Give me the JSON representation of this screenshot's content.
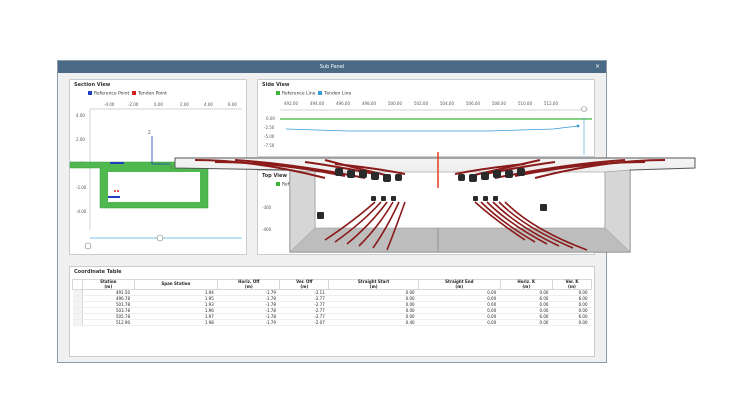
{
  "window": {
    "title": "Sub Panel",
    "close_glyph": "×"
  },
  "section_view": {
    "title": "Section View",
    "legend": [
      {
        "label": "Reference Point",
        "color": "#1f3fbf"
      },
      {
        "label": "Tendon Point",
        "color": "#d42020"
      }
    ],
    "x_ticks": [
      "-4.00",
      "-2.00",
      "0.00",
      "2.00",
      "4.00",
      "6.00"
    ],
    "y_ticks": [
      "4.00",
      "2.00",
      "0.00",
      "-2.00",
      "-4.00"
    ],
    "axis_z": "Z",
    "axis_y": "Y"
  },
  "side_view": {
    "title": "Side View",
    "legend": [
      {
        "label": "Reference Line",
        "color": "#3cb43c"
      },
      {
        "label": "Tendon Line",
        "color": "#3a9ad9"
      }
    ],
    "x_ticks": [
      "492.00",
      "494.00",
      "496.00",
      "498.00",
      "500.00",
      "502.00",
      "504.00",
      "506.00",
      "508.00",
      "510.00",
      "512.00"
    ],
    "y_ticks": [
      "0.00",
      "-2.50",
      "-5.00",
      "-7.50"
    ]
  },
  "top_view": {
    "title": "Top View",
    "legend_partial": "Refere",
    "y_ticks": [
      "-300",
      "-400"
    ]
  },
  "coordinate_table": {
    "title": "Coordinate Table",
    "headers": [
      "Station\n(m)",
      "Span Station",
      "Horiz. Off\n(m)",
      "Ver. Off\n(m)",
      "Straight Start\n(m)",
      "Straight End\n(m)",
      "Horiz. K\n(m)",
      "Ver. K\n(m)"
    ],
    "rows": [
      [
        "491.50",
        "1.94",
        "-1.79",
        "-2.11",
        "0.00",
        "0.00",
        "0.00",
        "0.00"
      ],
      [
        "496.78",
        "1.95",
        "-1.78",
        "-2.77",
        "0.00",
        "0.00",
        "6.00",
        "6.00"
      ],
      [
        "501.78",
        "1.93",
        "-1.78",
        "-2.77",
        "0.00",
        "0.00",
        "0.00",
        "0.00"
      ],
      [
        "503.78",
        "1.96",
        "-1.78",
        "-2.77",
        "0.00",
        "0.00",
        "0.00",
        "0.00"
      ],
      [
        "505.78",
        "1.97",
        "-1.78",
        "-2.77",
        "0.00",
        "0.00",
        "6.00",
        "6.00"
      ],
      [
        "512.90",
        "1.98",
        "-1.79",
        "-2.07",
        "0.40",
        "0.00",
        "0.00",
        "0.00"
      ]
    ]
  },
  "colors": {
    "deck": "#4fb84f",
    "tendon": "#8b1a1a",
    "accent": "#3a9ad9"
  }
}
